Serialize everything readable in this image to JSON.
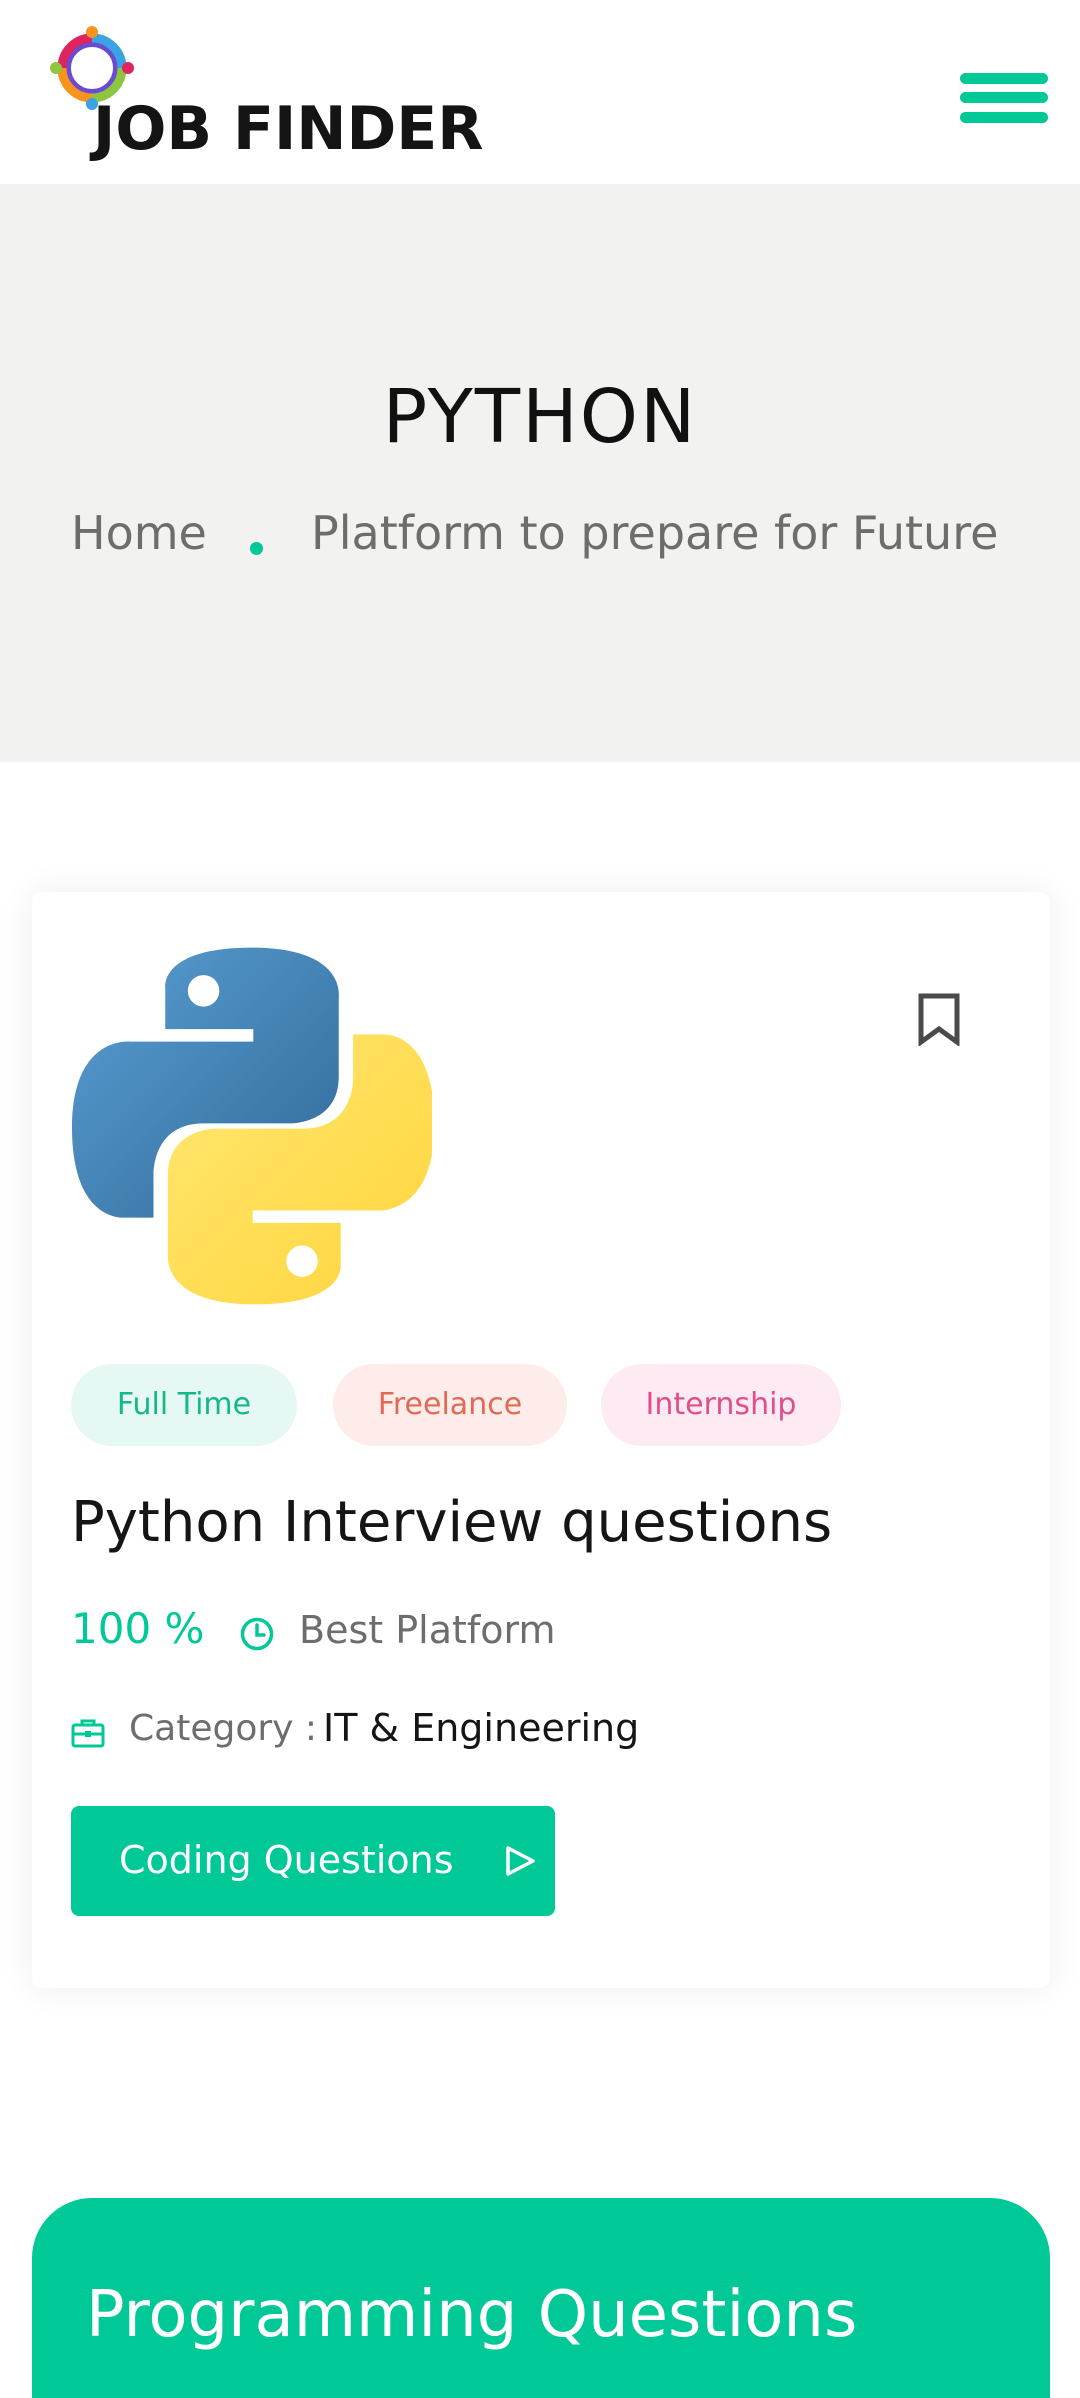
{
  "header": {
    "logo_text": "JOB FINDER",
    "menu_icon": "hamburger-menu-icon"
  },
  "hero": {
    "title": "PYTHON",
    "breadcrumb": {
      "home": "Home",
      "current": "Platform to prepare for Future"
    }
  },
  "card": {
    "logo_icon": "python-logo",
    "bookmark_icon": "bookmark-icon",
    "tags": {
      "full_time": "Full Time",
      "freelance": "Freelance",
      "internship": "Internship"
    },
    "title": "Python Interview questions",
    "percent": "100 %",
    "clock_icon": "clock-icon",
    "platform": "Best Platform",
    "category_icon": "briefcase-icon",
    "category_label": "Category :",
    "category_value": "IT & Engineering",
    "cta_label": "Coding Questions",
    "cta_icon": "play-arrow-icon"
  },
  "banner": {
    "title": "Programming Questions"
  },
  "colors": {
    "accent": "#00c896",
    "hero_bg": "#f2f3f0",
    "tag_full_bg": "#e6f8f3",
    "tag_full_text": "#16b78a",
    "tag_free_bg": "#fdece9",
    "tag_free_text": "#e26a55",
    "tag_intern_bg": "#fdeaf2",
    "tag_intern_text": "#e04e8c"
  }
}
